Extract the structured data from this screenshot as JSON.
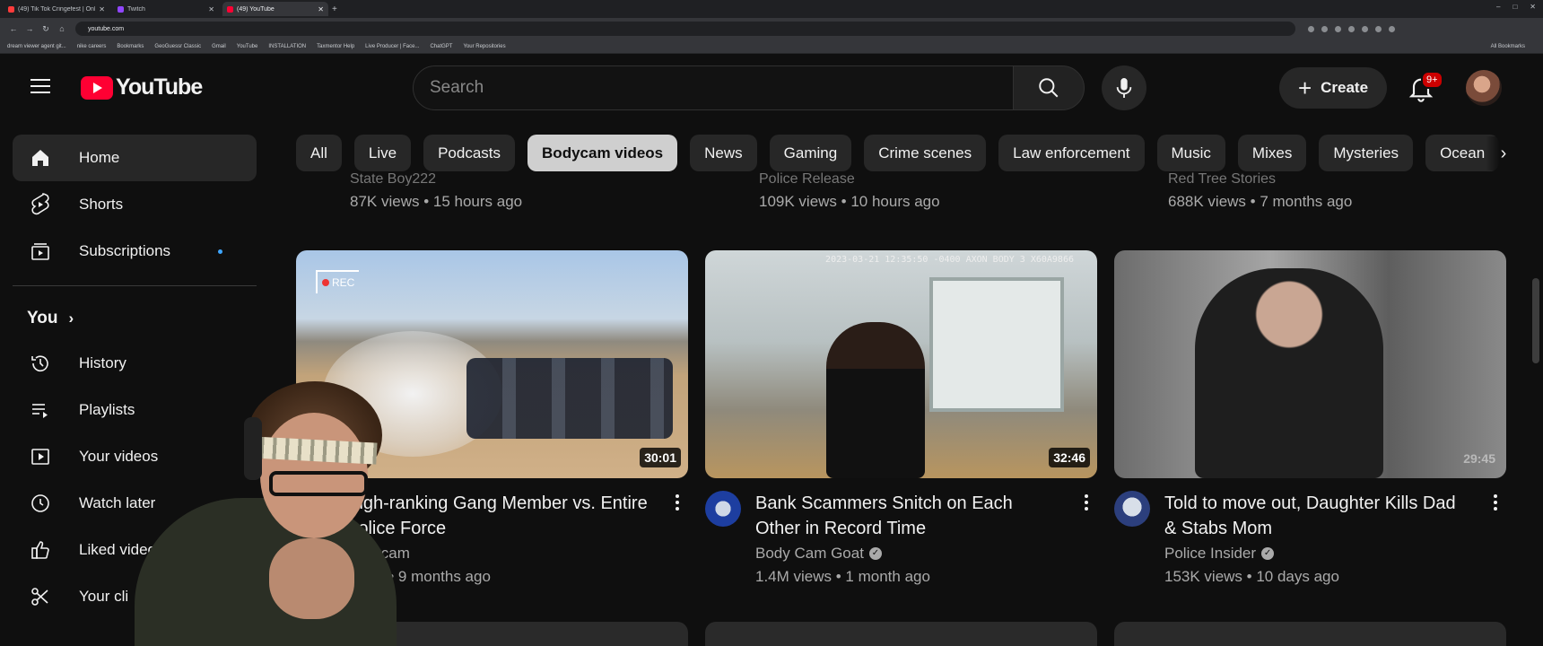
{
  "browser": {
    "tabs": [
      {
        "title": "(49) Tik Tok Cringefest | Only t...",
        "color": "#ff3b3b",
        "active": false
      },
      {
        "title": "Twitch",
        "color": "#9146ff",
        "active": false
      },
      {
        "title": "(49) YouTube",
        "color": "#ff0033",
        "active": true
      }
    ],
    "url": "youtube.com",
    "bookmarks": [
      "dream viewer agent git...",
      "nike careers",
      "Bookmarks",
      "GeoGuessr Classic",
      "Gmail",
      "YouTube",
      "INSTALLATION",
      "Taxmentor Help",
      "Live Producer | Face...",
      "ChatGPT",
      "Your Repositories"
    ],
    "all_bookmarks": "All Bookmarks"
  },
  "header": {
    "logo_text": "YouTube",
    "search_placeholder": "Search",
    "create_label": "Create",
    "notification_count": "9+"
  },
  "sidebar": {
    "items": [
      {
        "label": "Home",
        "icon": "home-icon",
        "active": true
      },
      {
        "label": "Shorts",
        "icon": "shorts-icon"
      },
      {
        "label": "Subscriptions",
        "icon": "subscriptions-icon",
        "has_dot": true
      }
    ],
    "you_label": "You",
    "you_items": [
      {
        "label": "History",
        "icon": "history-icon"
      },
      {
        "label": "Playlists",
        "icon": "playlists-icon"
      },
      {
        "label": "Your videos",
        "icon": "your-videos-icon"
      },
      {
        "label": "Watch later",
        "icon": "watch-later-icon"
      },
      {
        "label": "Liked video",
        "icon": "liked-videos-icon"
      },
      {
        "label": "Your cli",
        "icon": "clips-icon"
      }
    ]
  },
  "chips": [
    "All",
    "Live",
    "Podcasts",
    "Bodycam videos",
    "News",
    "Gaming",
    "Crime scenes",
    "Law enforcement",
    "Music",
    "Mixes",
    "Mysteries",
    "Ocean"
  ],
  "active_chip": "Bodycam videos",
  "previous_row": [
    {
      "channel": "State Boy222",
      "meta": "87K views • 15 hours ago"
    },
    {
      "channel": "Police Release",
      "meta": "109K views • 10 hours ago"
    },
    {
      "channel": "Red Tree Stories",
      "meta": "688K views • 7 months ago"
    }
  ],
  "videos": [
    {
      "title": "High-ranking Gang Member vs. Entire Police Force",
      "channel": "Bodycam",
      "meta": "views • 9 months ago",
      "duration": "30:01",
      "verified": false,
      "overlay": "REC"
    },
    {
      "title": "Bank Scammers Snitch on Each Other in Record Time",
      "channel": "Body Cam Goat",
      "meta": "1.4M views • 1 month ago",
      "duration": "32:46",
      "verified": true,
      "overlay": "2023-03-21 12:35:50 -0400 AXON BODY 3 X60A9866"
    },
    {
      "title": "Told to move out, Daughter Kills Dad & Stabs Mom",
      "channel": "Police Insider",
      "meta": "153K views • 10 days ago",
      "duration": "29:45",
      "verified": true
    }
  ]
}
